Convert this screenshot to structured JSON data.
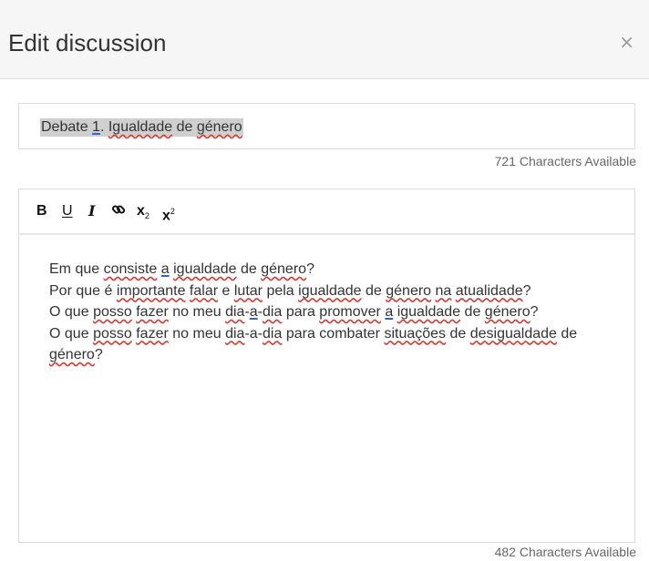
{
  "dialog": {
    "title": "Edit discussion",
    "close_glyph": "×"
  },
  "title_field": {
    "value": "Debate 1. Igualdade de género",
    "counter": "721 Characters Available"
  },
  "toolbar": {
    "bold": "B",
    "underline": "U",
    "italic": "I",
    "link_icon": "link-icon",
    "subscript": "x",
    "subscript_mark": "2",
    "superscript": "x",
    "superscript_mark": "2"
  },
  "body": {
    "lines": [
      "Em que consiste a igualdade de género?",
      "Por que é importante falar e lutar pela igualdade de género na atualidade?",
      "O que posso fazer no meu dia-a-dia para promover a igualdade de género?",
      "O que posso fazer no meu dia-a-dia para combater situações de desigualdade de género?"
    ],
    "counter": "482 Characters Available"
  }
}
